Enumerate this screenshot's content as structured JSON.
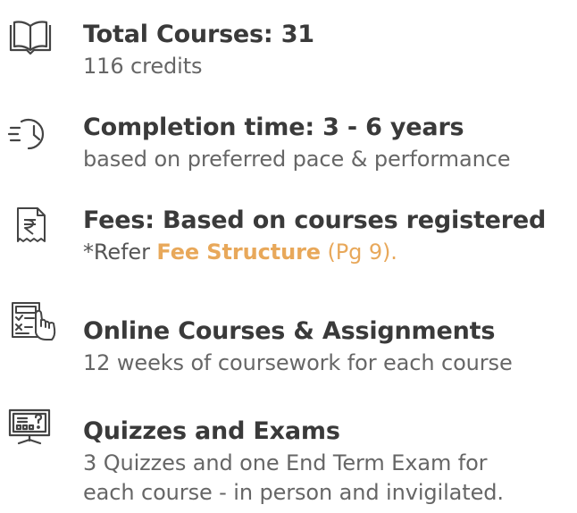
{
  "items": [
    {
      "icon": "open-book-icon",
      "title": "Total Courses: 31",
      "description": "116 credits"
    },
    {
      "icon": "clock-fast-icon",
      "title": "Completion time: 3 - 6 years",
      "description": "based on preferred pace & performance"
    },
    {
      "icon": "rupee-receipt-icon",
      "title": "Fees: Based on courses registered",
      "description_prefix": "*Refer ",
      "description_link": "Fee Structure",
      "description_suffix": " (Pg 9)."
    },
    {
      "icon": "checklist-hand-icon",
      "title": "Online Courses & Assignments",
      "description": "12 weeks of coursework for each course"
    },
    {
      "icon": "monitor-quiz-icon",
      "title": "Quizzes and Exams",
      "description_line1": "3 Quizzes and one End Term Exam for",
      "description_line2": "each course - in person and invigilated."
    }
  ],
  "colors": {
    "title": "#3a3a3a",
    "description": "#666666",
    "accent": "#e8a85a",
    "icon": "#444444"
  }
}
